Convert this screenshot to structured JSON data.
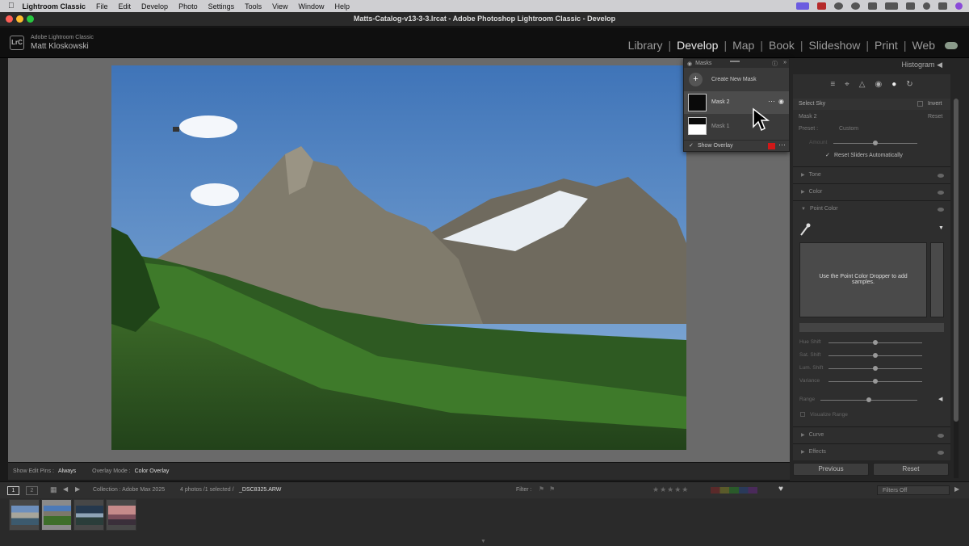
{
  "menubar": {
    "app": "Lightroom Classic",
    "items": [
      "File",
      "Edit",
      "Develop",
      "Photo",
      "Settings",
      "Tools",
      "View",
      "Window",
      "Help"
    ]
  },
  "window": {
    "title": "Matts-Catalog-v13-3-3.lrcat - Adobe Photoshop Lightroom Classic - Develop"
  },
  "identity": {
    "logo": "LrC",
    "app_sub": "Adobe Lightroom Classic",
    "user": "Matt Kloskowski"
  },
  "modules": [
    "Library",
    "Develop",
    "Map",
    "Book",
    "Slideshow",
    "Print",
    "Web"
  ],
  "active_module": "Develop",
  "masks": {
    "title": "Masks",
    "create": "Create New Mask",
    "items": [
      {
        "name": "Mask 2"
      },
      {
        "name": "Mask 1"
      }
    ],
    "show_overlay": "Show Overlay",
    "overlay_color": "#d01818"
  },
  "right": {
    "histogram": "Histogram",
    "select_label": "Select Sky",
    "invert": "Invert",
    "mask_name": "Mask 2",
    "reset": "Reset",
    "preset_label": "Preset :",
    "preset_value": "Custom",
    "amount": "Amount",
    "reset_sliders": "Reset Sliders Automatically",
    "sections": {
      "tone": "Tone",
      "color": "Color",
      "point_color": "Point Color",
      "curve": "Curve",
      "effects": "Effects"
    },
    "point_color_hint": "Use the Point Color Dropper to add samples.",
    "sliders": [
      "Hue Shift",
      "Sat. Shift",
      "Lum. Shift",
      "Variance"
    ],
    "range": "Range",
    "visualize": "Visualize Range",
    "previous": "Previous",
    "reset_btn": "Reset"
  },
  "toolbar": {
    "show_pins_label": "Show Edit Pins :",
    "show_pins_value": "Always",
    "overlay_label": "Overlay Mode :",
    "overlay_value": "Color Overlay"
  },
  "filmstrip": {
    "page1": "1",
    "page2": "2",
    "source": "Collection : Adobe Max 2025",
    "count": "4 photos /1 selected /",
    "filename": "_DSC8325.ARW",
    "filter_label": "Filter :",
    "filters_off": "Filters Off"
  }
}
